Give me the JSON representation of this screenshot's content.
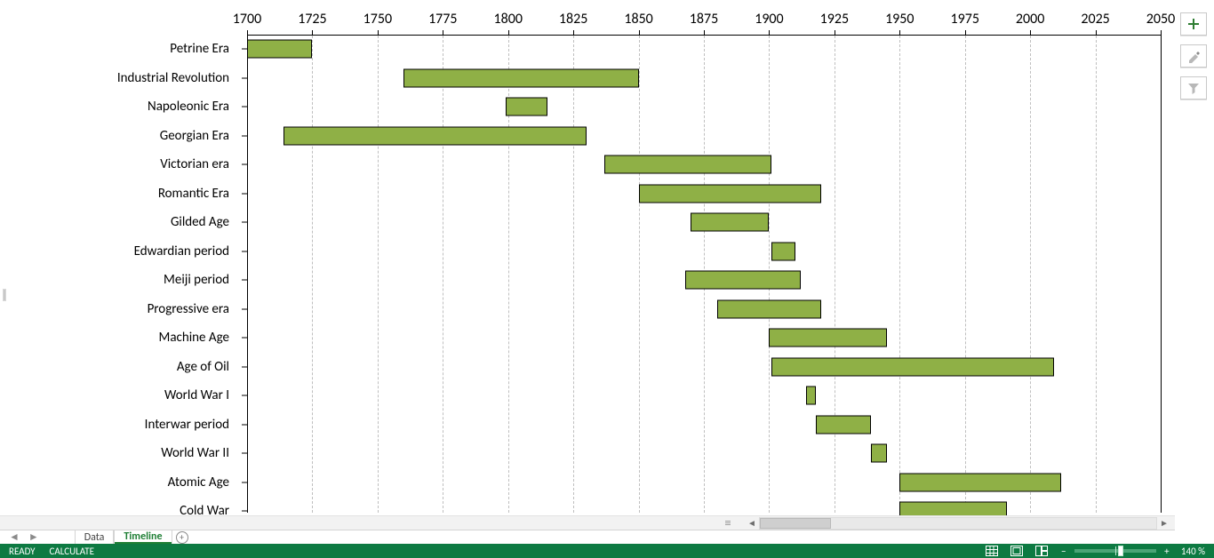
{
  "chart_data": {
    "type": "bar",
    "orientation": "horizontal-range",
    "xlabel": "",
    "ylabel": "",
    "xlim": [
      1700,
      2050
    ],
    "xticks": [
      1700,
      1725,
      1750,
      1775,
      1800,
      1825,
      1850,
      1875,
      1900,
      1925,
      1950,
      1975,
      2000,
      2025,
      2050
    ],
    "bar_color": "#8fb046",
    "bar_border": "#000000",
    "series": [
      {
        "name": "Petrine Era",
        "start": 1700,
        "end": 1725
      },
      {
        "name": "Industrial Revolution",
        "start": 1760,
        "end": 1850
      },
      {
        "name": "Napoleonic Era",
        "start": 1799,
        "end": 1815
      },
      {
        "name": "Georgian Era",
        "start": 1714,
        "end": 1830
      },
      {
        "name": "Victorian era",
        "start": 1837,
        "end": 1901
      },
      {
        "name": "Romantic Era",
        "start": 1850,
        "end": 1920
      },
      {
        "name": "Gilded Age",
        "start": 1870,
        "end": 1900
      },
      {
        "name": "Edwardian period",
        "start": 1901,
        "end": 1910
      },
      {
        "name": "Meiji period",
        "start": 1868,
        "end": 1912
      },
      {
        "name": "Progressive era",
        "start": 1880,
        "end": 1920
      },
      {
        "name": "Machine Age",
        "start": 1900,
        "end": 1945
      },
      {
        "name": "Age of Oil",
        "start": 1901,
        "end": 2009
      },
      {
        "name": "World War I",
        "start": 1914,
        "end": 1918
      },
      {
        "name": "Interwar period",
        "start": 1918,
        "end": 1939
      },
      {
        "name": "World War II",
        "start": 1939,
        "end": 1945
      },
      {
        "name": "Atomic Age",
        "start": 1950,
        "end": 2012
      },
      {
        "name": "Cold War",
        "start": 1950,
        "end": 1991
      }
    ]
  },
  "sheets": {
    "tab1_label": "Data",
    "tab2_label": "Timeline",
    "active": "Timeline"
  },
  "statusbar": {
    "ready": "READY",
    "calculate": "CALCULATE",
    "zoom_label": "140 %",
    "zoom_value": 140,
    "zoom_min": 10,
    "zoom_max": 400
  },
  "right_buttons": {
    "plus": "chart-elements",
    "brush": "chart-styles",
    "filter": "chart-filters"
  }
}
